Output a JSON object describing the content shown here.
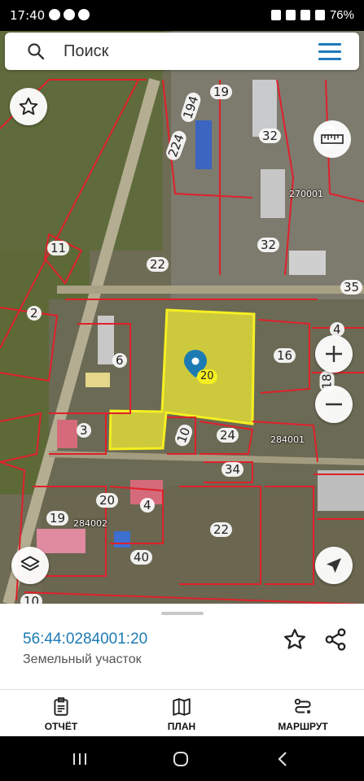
{
  "status_bar": {
    "time": "17:40",
    "battery": "76%"
  },
  "search": {
    "placeholder": "Поиск"
  },
  "map": {
    "labels": [
      "19",
      "194",
      "224",
      "32",
      "20",
      "270001",
      "11",
      "22",
      "32",
      "35",
      "2",
      "6",
      "20",
      "16",
      "4",
      "18",
      "3",
      "10",
      "24",
      "284001",
      "34",
      "19",
      "20",
      "4",
      "284002",
      "22",
      "40",
      "10"
    ],
    "selected_parcel": "20"
  },
  "parcel": {
    "cadastral_number": "56:44:0284001:20",
    "type": "Земельный участок"
  },
  "tabs": [
    {
      "label": "ОТЧЁТ",
      "icon": "report-icon"
    },
    {
      "label": "ПЛАН",
      "icon": "map-plan-icon"
    },
    {
      "label": "МАРШРУТ",
      "icon": "route-icon"
    }
  ],
  "colors": {
    "accent": "#1e7ab8",
    "parcel_border": "#e0202a",
    "selected_fill": "#f5f02a"
  }
}
